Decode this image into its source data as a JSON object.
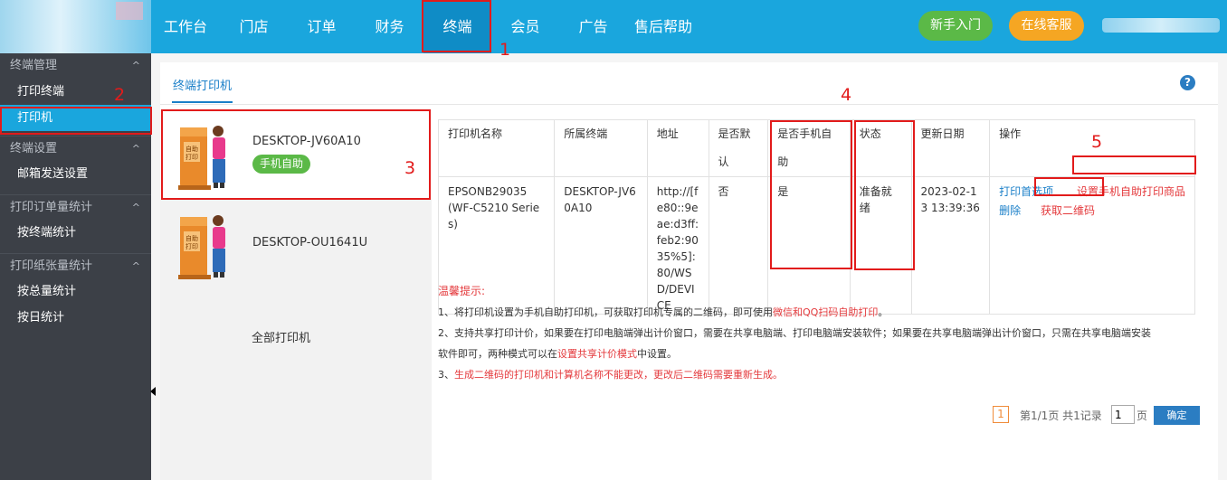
{
  "nav": {
    "items": [
      "工作台",
      "门店",
      "订单",
      "财务",
      "终端",
      "会员",
      "广告",
      "售后帮助"
    ],
    "active": "终端"
  },
  "header_buttons": {
    "guide": "新手入门",
    "service": "在线客服"
  },
  "sidebar": {
    "group_terminal": "终端管理",
    "item_print_terminal": "打印终端",
    "item_printer": "打印机",
    "group_settings": "终端设置",
    "item_mail": "邮箱发送设置",
    "group_order_stats": "打印订单量统计",
    "item_by_terminal": "按终端统计",
    "group_paper_stats": "打印纸张量统计",
    "item_total": "按总量统计",
    "item_daily": "按日统计"
  },
  "tab": "终端打印机",
  "printers": [
    {
      "name": "DESKTOP-JV60A10",
      "badge": "手机自助"
    },
    {
      "name": "DESKTOP-OU1641U"
    }
  ],
  "all_printers": "全部打印机",
  "table": {
    "headers": [
      "打印机名称",
      "所属终端",
      "地址",
      "是否默认",
      "是否手机自助",
      "状态",
      "更新日期",
      "操作"
    ],
    "row": {
      "printer_name": "EPSONB29035 (WF-C5210 Series)",
      "terminal": "DESKTOP-JV60A10",
      "address": "http://[fe80::9eae:d3ff:feb2:9035%5]:80/WSD/DEVICE",
      "is_default": "否",
      "is_mobile": "是",
      "status": "准备就绪",
      "updated": "2023-02-13 13:39:36",
      "actions": {
        "preferences": "打印首选项",
        "set_product": "设置手机自助打印商品",
        "delete": "删除",
        "get_qr": "获取二维码"
      }
    }
  },
  "tips": {
    "title": "温馨提示:",
    "l1_a": "1、将打印机设置为手机自助打印机，可获取打印机专属的二维码，即可使用",
    "l1_b": "微信和QQ扫码自助打印",
    "l1_c": "。",
    "l2_a": "2、支持共享打印计价，如果要在打印电脑端弹出计价窗口，需要在共享电脑端、打印电脑端安装软件；如果要在共享电脑端弹出计价窗口，只需在共享电脑端安装",
    "l2_b": "软件即可，两种模式可以在",
    "l2_c": "设置共享计价模式",
    "l2_d": "中设置。",
    "l3_a": "3、",
    "l3_b": "生成二维码的打印机和计算机名称不能更改，更改后二维码需要重新生成。"
  },
  "pager": {
    "current": "1",
    "info": "第1/1页 共1记录",
    "input_value": "1",
    "unit": "页",
    "confirm": "确定"
  },
  "annotations": [
    "1",
    "2",
    "3",
    "4",
    "5"
  ],
  "colors": {
    "header": "#1aa6dd",
    "sidebar": "#3c4047",
    "annotation": "#e21b1b",
    "link": "#1a7fc8"
  }
}
